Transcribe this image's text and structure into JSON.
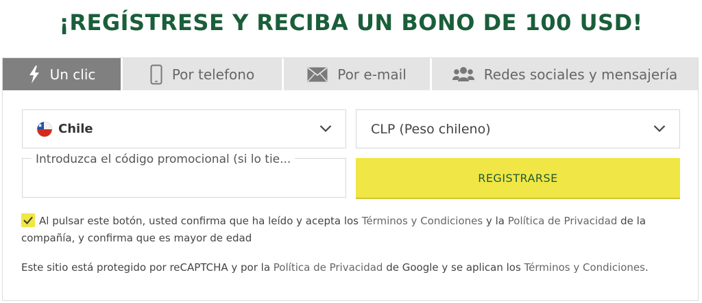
{
  "headline": "¡REGÍSTRESE Y RECIBA UN BONO DE 100 USD!",
  "tabs": [
    {
      "label": "Un clic",
      "icon": "lightning-icon",
      "active": true
    },
    {
      "label": "Por telefono",
      "icon": "phone-icon",
      "active": false
    },
    {
      "label": "Por e-mail",
      "icon": "envelope-icon",
      "active": false
    },
    {
      "label": "Redes sociales y mensajería",
      "icon": "users-icon",
      "active": false
    }
  ],
  "country_select": {
    "value": "Chile",
    "icon": "chile-flag-icon"
  },
  "currency_select": {
    "value": "CLP (Peso chileno)"
  },
  "promo": {
    "label": "Introduzca el código promocional (si lo tie..."
  },
  "register_button": "REGISTRARSE",
  "consent": {
    "checked": true,
    "text_1": "Al pulsar este botón, usted confirma que ha leído y acepta los ",
    "link_terms": "Términos y Condiciones",
    "text_2": " y la ",
    "link_privacy": "Política de Privacidad",
    "text_3": " de la compañía, y confirma que es mayor de edad"
  },
  "recaptcha": {
    "text_1": "Este sitio está protegido por reCAPTCHA y por la ",
    "link_privacy": "Política de Privacidad",
    "text_2": " de Google y se aplican los ",
    "link_terms": "Términos y Condiciones",
    "text_3": "."
  },
  "colors": {
    "headline": "#1a5e3a",
    "tab_active_bg": "#808080",
    "tab_bg": "#e4e4e4",
    "button_bg": "#f0e645",
    "button_text": "#1f5c35"
  }
}
